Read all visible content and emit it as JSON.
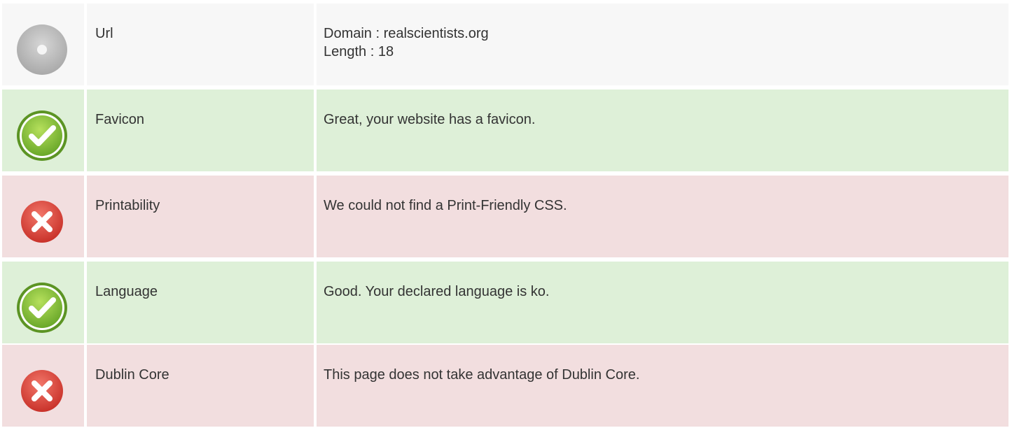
{
  "rows": [
    {
      "status": "neutral",
      "icon": "disc-icon",
      "label": "Url",
      "details": [
        "Domain : realscientists.org",
        "Length : 18"
      ]
    },
    {
      "status": "pass",
      "icon": "check-icon",
      "label": "Favicon",
      "details": [
        "Great, your website has a favicon."
      ]
    },
    {
      "status": "fail",
      "icon": "cross-icon",
      "label": "Printability",
      "details": [
        "We could not find a Print-Friendly CSS."
      ]
    },
    {
      "status": "pass",
      "icon": "check-icon",
      "label": "Language",
      "details": [
        "Good. Your declared language is ko."
      ]
    },
    {
      "status": "fail",
      "icon": "cross-icon",
      "label": "Dublin Core",
      "details": [
        "This page does not take advantage of Dublin Core."
      ]
    }
  ],
  "colors": {
    "neutral_bg": "#f7f7f7",
    "pass_bg": "#def0d8",
    "fail_bg": "#f2dedf",
    "text": "#333333"
  }
}
